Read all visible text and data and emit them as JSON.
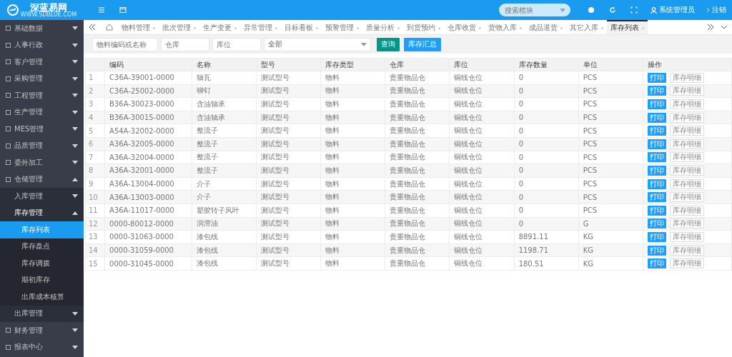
{
  "header": {
    "logo_text": "深蓝易网",
    "logo_url": "WWW.SDBLUE.COM",
    "search": {
      "placeholder": "搜索模块"
    },
    "user": "系统管理员",
    "logout": "注销"
  },
  "sidebar": {
    "items": [
      {
        "label": "基础数据",
        "expanded": false,
        "selected": false
      },
      {
        "label": "人事行政",
        "expanded": false,
        "selected": false
      },
      {
        "label": "客户管理",
        "expanded": false,
        "selected": false
      },
      {
        "label": "采购管理",
        "expanded": false,
        "selected": false
      },
      {
        "label": "工程管理",
        "expanded": false,
        "selected": false
      },
      {
        "label": "生产管理",
        "expanded": false,
        "selected": false
      },
      {
        "label": "MES管理",
        "expanded": false,
        "selected": false
      },
      {
        "label": "品质管理",
        "expanded": false,
        "selected": false
      },
      {
        "label": "委外加工",
        "expanded": false,
        "selected": false
      },
      {
        "label": "仓储管理",
        "expanded": true,
        "selected": false,
        "children": [
          {
            "label": "入库管理",
            "expanded": false,
            "selected": false
          },
          {
            "label": "库存管理",
            "expanded": true,
            "selected": false,
            "children": [
              {
                "label": "库存列表",
                "selected": true
              },
              {
                "label": "库存盘点",
                "selected": false
              },
              {
                "label": "库存调拨",
                "selected": false
              },
              {
                "label": "期初库存",
                "selected": false
              },
              {
                "label": "出库成本核算",
                "selected": false
              }
            ]
          },
          {
            "label": "出库管理",
            "expanded": false,
            "selected": false
          }
        ]
      },
      {
        "label": "财务管理",
        "expanded": false,
        "selected": false
      },
      {
        "label": "报表中心",
        "expanded": false,
        "selected": false
      }
    ]
  },
  "tabs": [
    {
      "label": "物料管理",
      "selected": false
    },
    {
      "label": "批次管理",
      "selected": false
    },
    {
      "label": "生产变更",
      "selected": false
    },
    {
      "label": "异常管理",
      "selected": false
    },
    {
      "label": "目标看板",
      "selected": false
    },
    {
      "label": "预警管理",
      "selected": false
    },
    {
      "label": "质量分析",
      "selected": false
    },
    {
      "label": "到货预约",
      "selected": false
    },
    {
      "label": "仓库收货",
      "selected": false
    },
    {
      "label": "货物入库",
      "selected": false
    },
    {
      "label": "成品退货",
      "selected": false
    },
    {
      "label": "其它入库",
      "selected": false
    },
    {
      "label": "库存列表",
      "selected": true
    }
  ],
  "filters": {
    "code": {
      "placeholder": "物料编码或名称"
    },
    "warehouse": {
      "placeholder": "仓库"
    },
    "location": {
      "placeholder": "库位"
    },
    "type": {
      "value": "全部"
    },
    "buttons": [
      "查询",
      "库存汇总"
    ]
  },
  "table": {
    "columns": [
      "编码",
      "名称",
      "型号",
      "库存类型",
      "仓库",
      "库位",
      "库存数量",
      "单位",
      "操作"
    ],
    "rows": [
      {
        "index": "1",
        "cells": [
          "C36A-39001-0000",
          "轴瓦",
          "测试型号",
          "物料",
          "贵重物品仓",
          "铜线仓位",
          "0",
          "PCS"
        ],
        "actions": [
          "打印",
          "库存明细"
        ]
      },
      {
        "index": "2",
        "cells": [
          "C36A-25002-0000",
          "铆钉",
          "测试型号",
          "物料",
          "贵重物品仓",
          "铜线仓位",
          "0",
          "PCS"
        ],
        "actions": [
          "打印",
          "库存明细"
        ]
      },
      {
        "index": "3",
        "cells": [
          "B36A-30023-0000",
          "含油轴承",
          "测试型号",
          "物料",
          "贵重物品仓",
          "铜线仓位",
          "0",
          "PCS"
        ],
        "actions": [
          "打印",
          "库存明细"
        ]
      },
      {
        "index": "4",
        "cells": [
          "B36A-30015-0000",
          "含油轴承",
          "测试型号",
          "物料",
          "贵重物品仓",
          "铜线仓位",
          "0",
          "PCS"
        ],
        "actions": [
          "打印",
          "库存明细"
        ]
      },
      {
        "index": "5",
        "cells": [
          "A54A-32002-0000",
          "整流子",
          "测试型号",
          "物料",
          "贵重物品仓",
          "铜线仓位",
          "0",
          "PCS"
        ],
        "actions": [
          "打印",
          "库存明细"
        ]
      },
      {
        "index": "6",
        "cells": [
          "A36A-32005-0000",
          "整流子",
          "测试型号",
          "物料",
          "贵重物品仓",
          "铜线仓位",
          "0",
          "PCS"
        ],
        "actions": [
          "打印",
          "库存明细"
        ]
      },
      {
        "index": "7",
        "cells": [
          "A36A-32004-0000",
          "整流子",
          "测试型号",
          "物料",
          "贵重物品仓",
          "铜线仓位",
          "0",
          "PCS"
        ],
        "actions": [
          "打印",
          "库存明细"
        ]
      },
      {
        "index": "8",
        "cells": [
          "A36A-32001-0000",
          "整流子",
          "测试型号",
          "物料",
          "贵重物品仓",
          "铜线仓位",
          "0",
          "PCS"
        ],
        "actions": [
          "打印",
          "库存明细"
        ]
      },
      {
        "index": "9",
        "cells": [
          "A36A-13004-0000",
          "介子",
          "测试型号",
          "物料",
          "贵重物品仓",
          "铜线仓位",
          "0",
          "PCS"
        ],
        "actions": [
          "打印",
          "库存明细"
        ]
      },
      {
        "index": "10",
        "cells": [
          "A36A-13003-0000",
          "介子",
          "测试型号",
          "物料",
          "贵重物品仓",
          "铜线仓位",
          "0",
          "PCS"
        ],
        "actions": [
          "打印",
          "库存明细"
        ]
      },
      {
        "index": "11",
        "cells": [
          "A36A-11017-0000",
          "塑胶转子风叶",
          "测试型号",
          "物料",
          "贵重物品仓",
          "铜线仓位",
          "0",
          "PCS"
        ],
        "actions": [
          "打印",
          "库存明细"
        ]
      },
      {
        "index": "12",
        "cells": [
          "0000-80012-0000",
          "润滑油",
          "测试型号",
          "物料",
          "贵重物品仓",
          "铜线仓位",
          "0",
          "G"
        ],
        "actions": [
          "打印",
          "库存明细"
        ]
      },
      {
        "index": "13",
        "cells": [
          "0000-31063-0000",
          "漆包线",
          "测试型号",
          "物料",
          "贵重物品仓",
          "铜线仓位",
          "8891.11",
          "KG"
        ],
        "actions": [
          "打印",
          "库存明细"
        ]
      },
      {
        "index": "14",
        "cells": [
          "0000-31059-0000",
          "漆包线",
          "测试型号",
          "物料",
          "贵重物品仓",
          "铜线仓位",
          "1198.71",
          "KG"
        ],
        "actions": [
          "打印",
          "库存明细"
        ]
      },
      {
        "index": "15",
        "cells": [
          "0000-31045-0000",
          "漆包线",
          "测试型号",
          "物料",
          "贵重物品仓",
          "铜线仓位",
          "180.51",
          "KG"
        ],
        "actions": [
          "打印",
          "库存明细"
        ]
      }
    ]
  }
}
